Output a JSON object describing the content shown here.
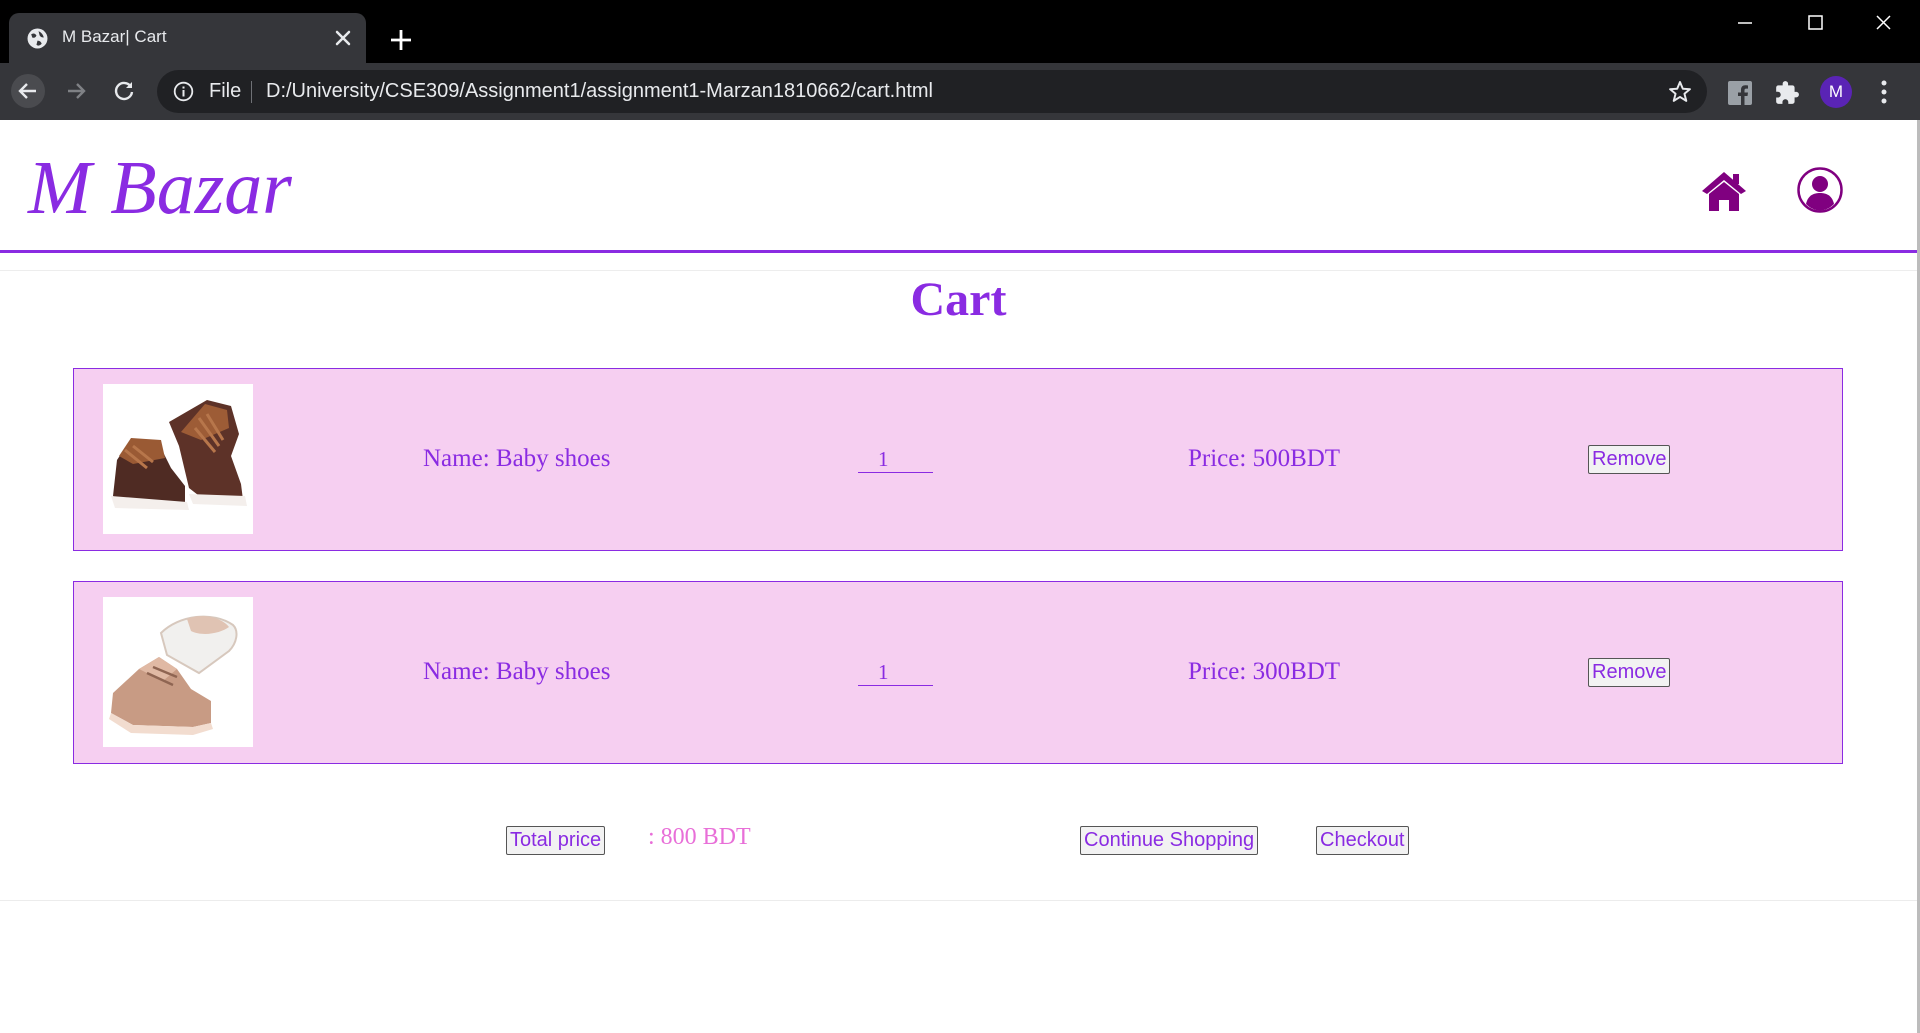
{
  "browser": {
    "tab_title": "M Bazar| Cart",
    "omnibox_scheme": "File",
    "url": "D:/University/CSE309/Assignment1/assignment1-Marzan1810662/cart.html",
    "profile_initial": "M"
  },
  "site": {
    "logo": "M Bazar",
    "brand_color": "#8a2be2",
    "nav_icons": [
      "home-icon",
      "user-icon"
    ]
  },
  "cart": {
    "title": "Cart",
    "items": [
      {
        "name": "Name: Baby shoes",
        "quantity": "1",
        "price": "Price: 500BDT",
        "remove_label": "Remove",
        "image": "brown-baby-sneakers"
      },
      {
        "name": "Name: Baby shoes",
        "quantity": "1",
        "price": "Price: 300BDT",
        "remove_label": "Remove",
        "image": "tan-baby-shoes"
      }
    ],
    "total_label": "Total price",
    "total_value": ": 800 BDT",
    "continue_label": "Continue Shopping",
    "checkout_label": "Checkout",
    "row_background": "#f6cff1",
    "total_color": "#e86fd8"
  }
}
